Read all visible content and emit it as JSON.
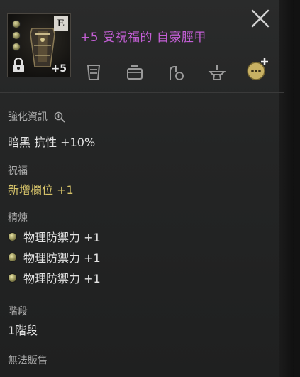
{
  "header": {
    "title": "+5 受祝福的 自豪脛甲",
    "grade": "E",
    "enhance_level": "+5"
  },
  "action_icons": [
    "armor-icon",
    "chest-icon",
    "hand-bag-icon",
    "anvil-icon",
    "chat-plus-icon"
  ],
  "enhance_info": {
    "label": "強化資訊",
    "stat": "暗黑 抗性 +10%"
  },
  "blessing": {
    "label": "祝福",
    "value": "新增欄位 +1"
  },
  "refine": {
    "label": "精煉",
    "items": [
      "物理防禦力 +1",
      "物理防禦力 +1",
      "物理防禦力 +1"
    ]
  },
  "tier": {
    "label": "階段",
    "value": "1階段"
  },
  "footer": {
    "unsellable": "無法販售"
  },
  "colors": {
    "title": "#c45fd6",
    "gold": "#d7c46a",
    "text": "#e4e4e4",
    "label": "#a9a9a9"
  }
}
